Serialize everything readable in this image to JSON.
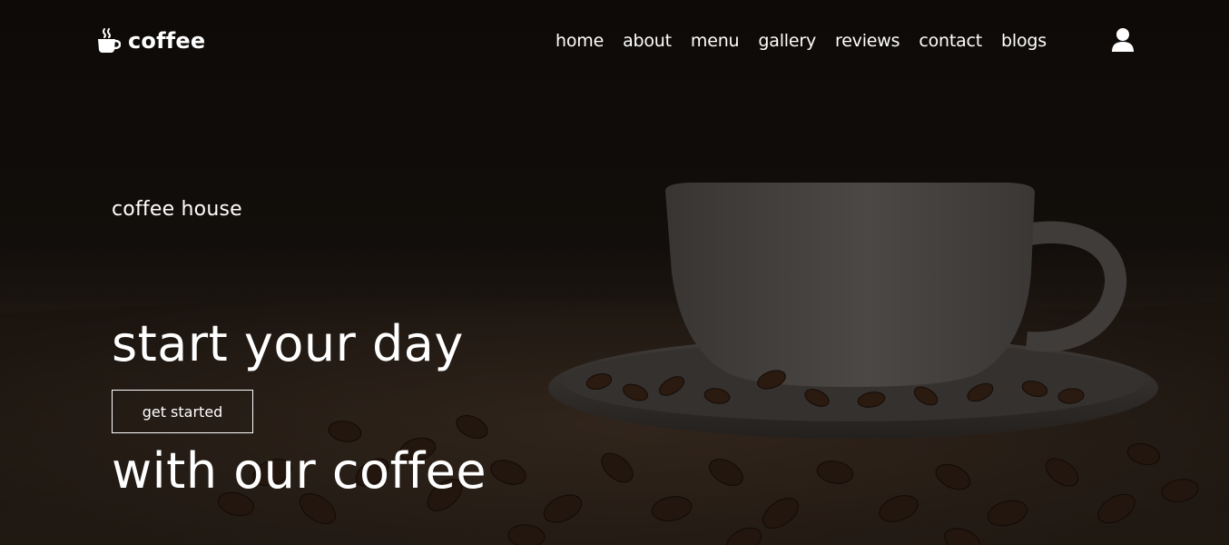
{
  "brand": {
    "name": "coffee",
    "icon": "coffee-cup-icon"
  },
  "nav": {
    "items": [
      {
        "label": "home"
      },
      {
        "label": "about"
      },
      {
        "label": "menu"
      },
      {
        "label": "gallery"
      },
      {
        "label": "reviews"
      },
      {
        "label": "contact"
      },
      {
        "label": "blogs"
      }
    ],
    "account_icon": "user-icon"
  },
  "hero": {
    "eyebrow": "coffee house",
    "headline_line1": "start your day",
    "headline_line2": "with our coffee",
    "cta_label": "get started"
  },
  "colors": {
    "text": "#ffffff",
    "background": "#0e0b09",
    "accent_cup": "#4a4644"
  }
}
